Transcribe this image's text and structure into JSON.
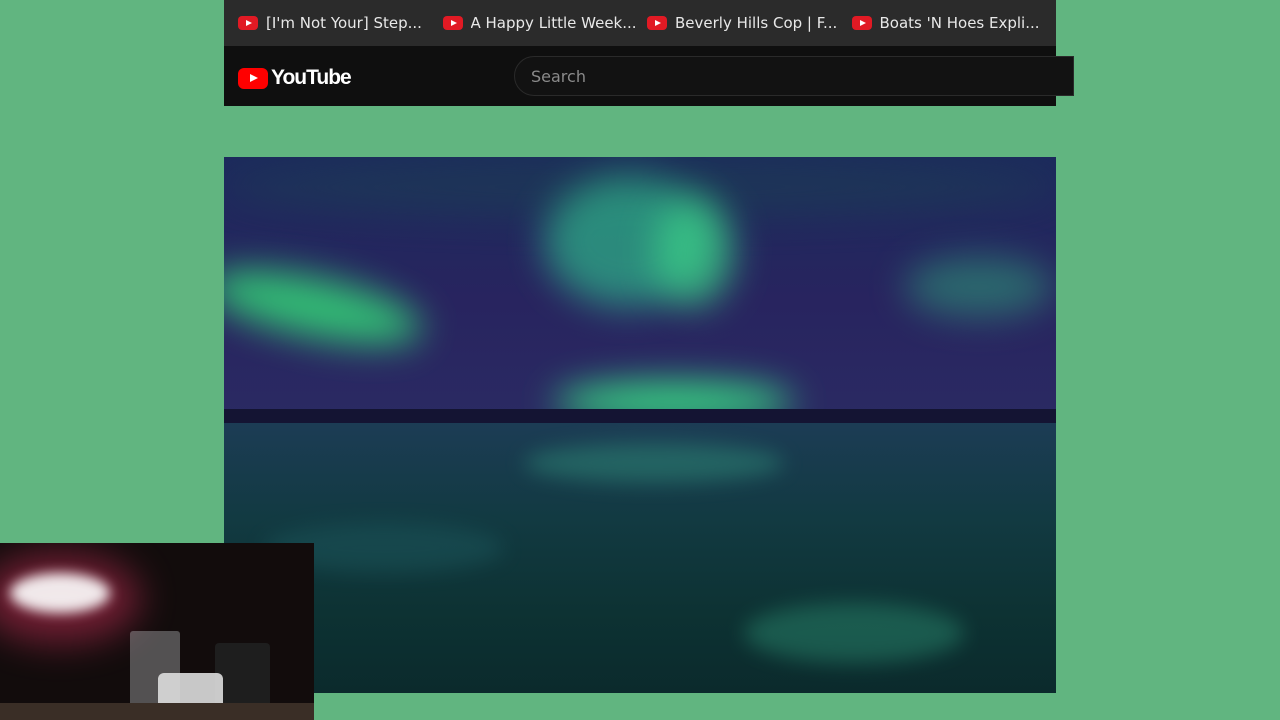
{
  "bookmarks": [
    {
      "label": "[I'm Not Your] Step...",
      "icon": "youtube-icon"
    },
    {
      "label": "A Happy Little Week...",
      "icon": "youtube-icon"
    },
    {
      "label": "Beverly Hills Cop | F...",
      "icon": "youtube-icon"
    },
    {
      "label": "Boats 'N Hoes Expli...",
      "icon": "youtube-icon"
    }
  ],
  "masthead": {
    "logo_text": "YouTube",
    "search_placeholder": "Search"
  },
  "colors": {
    "page_background": "#61b580",
    "bookmarks_bar": "#2b2b2b",
    "masthead": "#0f0f0f",
    "brand_red": "#ff0000"
  }
}
